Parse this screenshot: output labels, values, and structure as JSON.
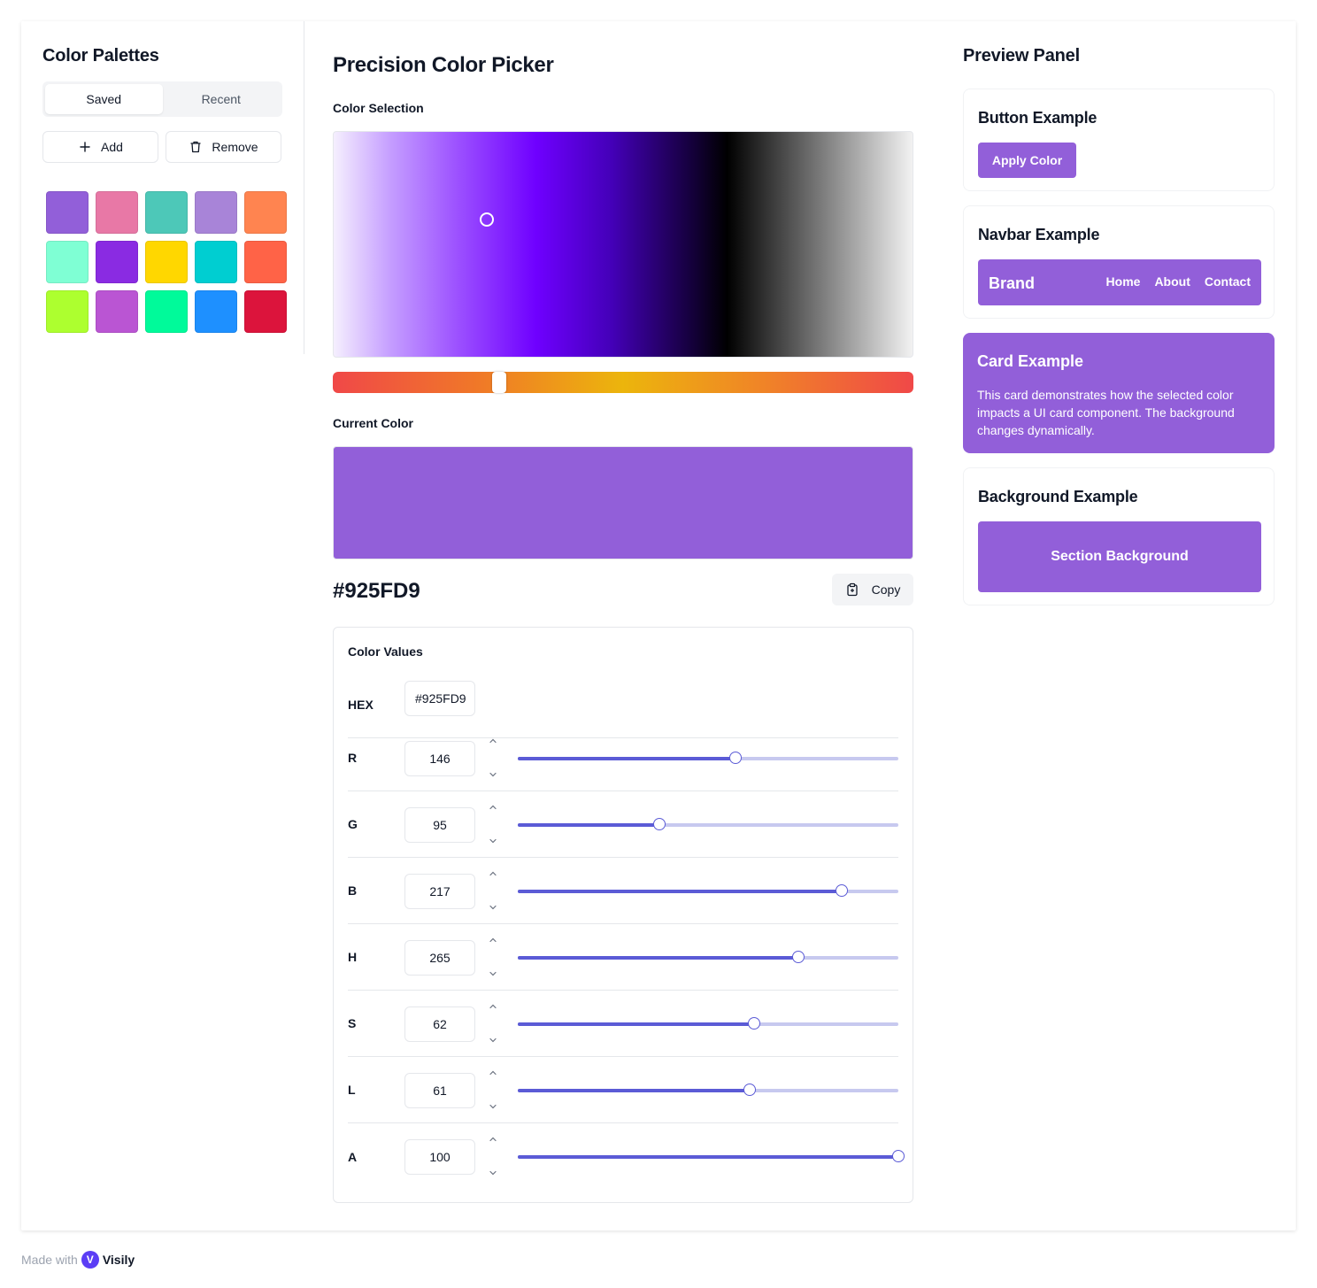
{
  "sidebar": {
    "title": "Color Palettes",
    "tabs": [
      {
        "label": "Saved",
        "active": true
      },
      {
        "label": "Recent",
        "active": false
      }
    ],
    "add_label": "Add",
    "remove_label": "Remove",
    "swatches": [
      "#925FD9",
      "#E878A6",
      "#4DC8B8",
      "#A884D8",
      "#FF8450",
      "#7FFFD4",
      "#8A2BE2",
      "#FFD700",
      "#00CED1",
      "#FF6347",
      "#ADFF2F",
      "#BA55D3",
      "#00FA9A",
      "#1E90FF",
      "#DC143C"
    ]
  },
  "main": {
    "title": "Precision Color Picker",
    "color_selection_label": "Color Selection",
    "current_color_label": "Current Color",
    "current_color": "#925FD9",
    "hex_display": "#925FD9",
    "copy_label": "Copy",
    "values": {
      "title": "Color Values",
      "hex_label": "HEX",
      "hex_value": "#925FD9",
      "channels": [
        {
          "label": "R",
          "value": "146",
          "fraction": 0.5725
        },
        {
          "label": "G",
          "value": "95",
          "fraction": 0.3725
        },
        {
          "label": "B",
          "value": "217",
          "fraction": 0.851
        },
        {
          "label": "H",
          "value": "265",
          "fraction": 0.7361
        },
        {
          "label": "S",
          "value": "62",
          "fraction": 0.62
        },
        {
          "label": "L",
          "value": "61",
          "fraction": 0.61
        },
        {
          "label": "A",
          "value": "100",
          "fraction": 1.0
        }
      ]
    }
  },
  "preview": {
    "title": "Preview Panel",
    "button_example": {
      "title": "Button Example",
      "button_label": "Apply Color"
    },
    "navbar_example": {
      "title": "Navbar Example",
      "brand": "Brand",
      "links": [
        "Home",
        "About",
        "Contact"
      ]
    },
    "card_example": {
      "title": "Card Example",
      "text": "This card demonstrates how the selected color impacts a UI card component. The background changes dynamically."
    },
    "background_example": {
      "title": "Background Example",
      "section_label": "Section Background"
    }
  },
  "footer": {
    "made_with": "Made with",
    "brand": "Visily"
  },
  "icons": {
    "add": "plus-icon",
    "remove": "trash-icon",
    "copy": "clipboard-icon",
    "increment": "chevron-up-icon",
    "decrement": "chevron-down-icon"
  },
  "colors": {
    "accent": "#925FD9",
    "slider": "#5B5BD6"
  }
}
